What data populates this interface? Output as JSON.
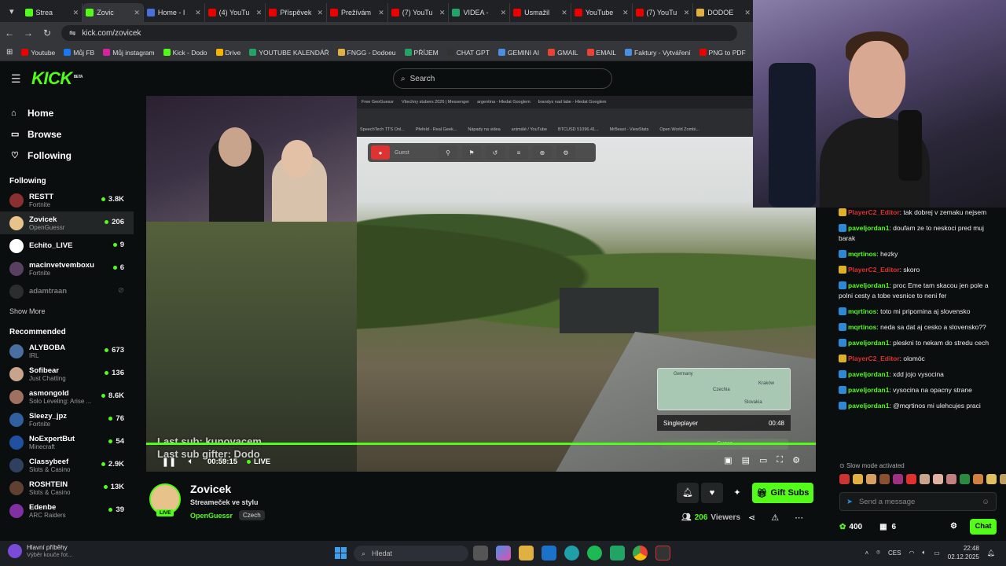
{
  "browser": {
    "tabs": [
      {
        "label": "Strea",
        "color": "#53fc18"
      },
      {
        "label": "Zovic",
        "color": "#53fc18",
        "active": true
      },
      {
        "label": "Home - I",
        "color": "#4a6ee0"
      },
      {
        "label": "(4) YouTu",
        "color": "#e00"
      },
      {
        "label": "Příspěvek",
        "color": "#e00"
      },
      {
        "label": "Prežívám",
        "color": "#e00"
      },
      {
        "label": "(7) YouTu",
        "color": "#e00"
      },
      {
        "label": "VIDEA - ",
        "color": "#21a464"
      },
      {
        "label": "Usmažil",
        "color": "#e00"
      },
      {
        "label": "YouTube",
        "color": "#e00"
      },
      {
        "label": "(7) YouTu",
        "color": "#e00"
      },
      {
        "label": "DODOE",
        "color": "#e0b040"
      }
    ],
    "url": "kick.com/zovicek",
    "bookmarks": [
      {
        "label": "Youtube",
        "color": "#e00"
      },
      {
        "label": "Můj FB",
        "color": "#1877f2"
      },
      {
        "label": "Můj instagram",
        "color": "#d6249f"
      },
      {
        "label": "Kick - Dodo",
        "color": "#53fc18"
      },
      {
        "label": "Drive",
        "color": "#f4b400"
      },
      {
        "label": "YOUTUBE KALENDÁŘ",
        "color": "#21a464"
      },
      {
        "label": "FNGG - Dodoeu",
        "color": "#e0b040"
      },
      {
        "label": "PŘÍJEM",
        "color": "#21a464"
      },
      {
        "label": "CHAT GPT",
        "color": "#333"
      },
      {
        "label": "GEMINI AI",
        "color": "#4a90e2"
      },
      {
        "label": "GMAIL",
        "color": "#ea4335"
      },
      {
        "label": "EMAIL",
        "color": "#ea4335"
      },
      {
        "label": "Faktury - Vytváření",
        "color": "#4a90e2"
      },
      {
        "label": "PNG to PDF",
        "color": "#e00"
      }
    ]
  },
  "topnav": {
    "logo": "KICK",
    "logo_sup": "BETA",
    "search_placeholder": "Search"
  },
  "sidebar": {
    "nav": [
      {
        "label": "Home",
        "icon": "⌂"
      },
      {
        "label": "Browse",
        "icon": "▭"
      },
      {
        "label": "Following",
        "icon": "♡"
      }
    ],
    "following_header": "Following",
    "following": [
      {
        "name": "RESTT",
        "game": "Fortnite",
        "count": "3.8K",
        "color": "#8a3030"
      },
      {
        "name": "Zovicek",
        "game": "OpenGuessr",
        "count": "206",
        "color": "#e7c28a",
        "selected": true
      },
      {
        "name": "Echito_LIVE",
        "game": "",
        "count": "9",
        "color": "#ffffff"
      },
      {
        "name": "macinvetvemboxu",
        "game": "Fortnite",
        "count": "6",
        "color": "#5a4060"
      },
      {
        "name": "adamtraan",
        "game": "",
        "count": "",
        "color": "#555555",
        "offline": true
      }
    ],
    "show_more": "Show More",
    "recommended_header": "Recommended",
    "recommended": [
      {
        "name": "ALYBOBA",
        "game": "IRL",
        "count": "673",
        "color": "#4a6ea0"
      },
      {
        "name": "Sofibear",
        "game": "Just Chatting",
        "count": "136",
        "color": "#c9a48c"
      },
      {
        "name": "asmongold",
        "game": "Solo Leveling: Arise ...",
        "count": "8.6K",
        "color": "#a07060"
      },
      {
        "name": "Sleezy_jpz",
        "game": "Fortnite",
        "count": "76",
        "color": "#3060a0"
      },
      {
        "name": "NoExpertBut",
        "game": "Minecraft",
        "count": "54",
        "color": "#2050a0"
      },
      {
        "name": "Classybeef",
        "game": "Slots & Casino",
        "count": "2.9K",
        "color": "#304060"
      },
      {
        "name": "ROSHTEIN",
        "game": "Slots & Casino",
        "count": "13K",
        "color": "#604030"
      },
      {
        "name": "Edenbe",
        "game": "ARC Raiders",
        "count": "39",
        "color": "#8030a0"
      }
    ]
  },
  "player": {
    "overlay_sub1": "Last sub: kunovacem",
    "overlay_sub2": "Last sub gifter: Dodo",
    "time": "00:59:15",
    "live": "LIVE",
    "singleplayer": "Singleplayer",
    "round_time": "00:48",
    "guess": "Guess",
    "map_labels": [
      "Germany",
      "Czechia",
      "Kraków",
      "Slovakia"
    ],
    "inner_tabs": [
      "Free GeoGuessr",
      "Všechny stubers 2026 | Messenger",
      "argentina - Hledat Googlem",
      "brandys nad labe - Hledat Googlem"
    ],
    "inner_bookmarks": [
      "SpeechTech TTS Onl...",
      "Pfefeld - Real Geek...",
      "Nápady na videa",
      "animálé / YouTube",
      "BTCUSD 51096.41...",
      "MrBeast - ViewStats",
      "Open World Zombi..."
    ],
    "inner_player_name": "Guest"
  },
  "stream": {
    "name": "Zovicek",
    "title": "Streameček ve stylu",
    "category": "OpenGuessr",
    "language": "Czech",
    "live_badge": "LIVE",
    "gift_subs": "Gift Subs",
    "viewers_count": "206",
    "viewers_label": "Viewers"
  },
  "chat": {
    "messages": [
      {
        "user": "PlayerC2_Editor",
        "text": "tak dobrej v zemaku nejsem",
        "color": "#e03030",
        "badge": "#e0b020"
      },
      {
        "user": "paveljordan1",
        "text": "doufam ze to neskoci pred muj barak",
        "color": "#53fc18",
        "badge": "#2a8ad6"
      },
      {
        "user": "mqrtinos",
        "text": "hezky",
        "color": "#53fc18",
        "badge": "#2a8ad6"
      },
      {
        "user": "PlayerC2_Editor",
        "text": "skoro",
        "color": "#e03030",
        "badge": "#e0b020"
      },
      {
        "user": "paveljordan1",
        "text": "proc Eme tam skacou jen pole a polni cesty a tobe vesnice to neni fer",
        "color": "#53fc18",
        "badge": "#2a8ad6"
      },
      {
        "user": "mqrtinos",
        "text": "toto mi pripomina aj slovensko",
        "color": "#53fc18",
        "badge": "#2a8ad6"
      },
      {
        "user": "mqrtinos",
        "text": "neda sa dat aj cesko a slovensko??",
        "color": "#53fc18",
        "badge": "#2a8ad6"
      },
      {
        "user": "paveljordan1",
        "text": "pleskni to nekam do stredu cech",
        "color": "#53fc18",
        "badge": "#2a8ad6"
      },
      {
        "user": "PlayerC2_Editor",
        "text": "olomóc",
        "color": "#e03030",
        "badge": "#e0b020"
      },
      {
        "user": "paveljordan1",
        "text": "xdd jojo vysocina",
        "color": "#53fc18",
        "badge": "#2a8ad6"
      },
      {
        "user": "paveljordan1",
        "text": "vysocina na opacny strane",
        "color": "#53fc18",
        "badge": "#2a8ad6"
      },
      {
        "user": "paveljordan1",
        "text": "@mqrtinos mi ulehcujes praci",
        "color": "#53fc18",
        "badge": "#2a8ad6"
      }
    ],
    "slow_mode": "Slow mode activated",
    "input_placeholder": "Send a message",
    "points": "400",
    "subs": "6",
    "chat_button": "Chat"
  },
  "taskbar": {
    "news_title": "Hlavní příběhy",
    "news_sub": "Výběr kouče fot...",
    "search": "Hledat",
    "lang": "CES",
    "time": "22:48",
    "date": "02.12.2025"
  }
}
